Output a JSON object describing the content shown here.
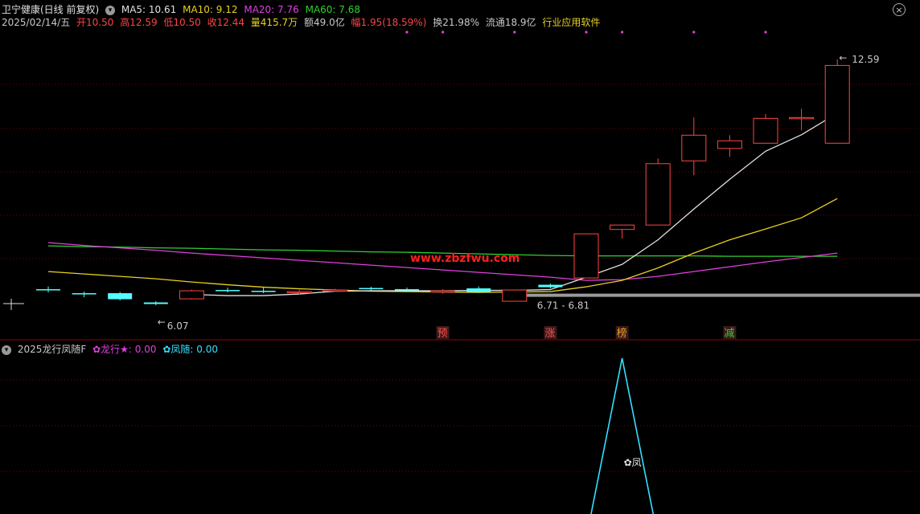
{
  "header": {
    "stock_name": "卫宁健康(日线 前复权)",
    "ma5": "MA5: 10.61",
    "ma10": "MA10: 9.12",
    "ma20": "MA20: 7.76",
    "ma60": "MA60: 7.68",
    "date": "2025/02/14/五",
    "open": "开10.50",
    "high": "高12.59",
    "low": "低10.50",
    "close": "收12.44",
    "volume": "量415.7万",
    "amount": "额49.0亿",
    "change": "幅1.95(18.59%)",
    "turnover": "换21.98%",
    "float": "流通18.9亿",
    "industry": "行业应用软件"
  },
  "indicator": {
    "name": "2025龙行凤随F",
    "long_label": "✿龙行★: 0.00",
    "feng_label": "✿凤随: 0.00",
    "feng_mark": "✿凤"
  },
  "colors": {
    "up": "#ff4444",
    "down": "#54ffff",
    "ma5": "#e0e0e0",
    "ma10": "#e8d020",
    "ma20": "#e040e0",
    "ma60": "#30d030",
    "grid": "#7a0000",
    "indicator": "#33e0ff"
  },
  "watermark": "www.zbzfwu.com",
  "chart_data": {
    "type": "candlestick",
    "price_range": [
      5.7,
      13.35
    ],
    "candles": [
      {
        "o": 6.86,
        "h": 6.93,
        "l": 6.78,
        "c": 6.84
      },
      {
        "o": 6.76,
        "h": 6.8,
        "l": 6.66,
        "c": 6.75
      },
      {
        "o": 6.76,
        "h": 6.79,
        "l": 6.58,
        "c": 6.61
      },
      {
        "o": 6.53,
        "h": 6.56,
        "l": 6.46,
        "c": 6.49
      },
      {
        "o": 6.62,
        "h": 6.85,
        "l": 6.6,
        "c": 6.82
      },
      {
        "o": 6.84,
        "h": 6.9,
        "l": 6.78,
        "c": 6.81
      },
      {
        "o": 6.82,
        "h": 6.9,
        "l": 6.76,
        "c": 6.79
      },
      {
        "o": 6.77,
        "h": 6.84,
        "l": 6.73,
        "c": 6.8
      },
      {
        "o": 6.82,
        "h": 6.87,
        "l": 6.8,
        "c": 6.84
      },
      {
        "o": 6.89,
        "h": 6.92,
        "l": 6.82,
        "c": 6.86
      },
      {
        "o": 6.86,
        "h": 6.9,
        "l": 6.84,
        "c": 6.85
      },
      {
        "o": 6.79,
        "h": 6.86,
        "l": 6.75,
        "c": 6.82
      },
      {
        "o": 6.88,
        "h": 6.93,
        "l": 6.77,
        "c": 6.79
      },
      {
        "o": 6.56,
        "h": 6.84,
        "l": 6.56,
        "c": 6.84
      },
      {
        "o": 6.97,
        "h": 7.0,
        "l": 6.88,
        "c": 6.91
      },
      {
        "o": 7.14,
        "h": 8.24,
        "l": 7.14,
        "c": 8.24
      },
      {
        "o": 8.35,
        "h": 8.46,
        "l": 8.12,
        "c": 8.46
      },
      {
        "o": 8.46,
        "h": 10.12,
        "l": 8.46,
        "c": 9.99
      },
      {
        "o": 10.06,
        "h": 11.14,
        "l": 9.7,
        "c": 10.7
      },
      {
        "o": 10.37,
        "h": 10.7,
        "l": 10.16,
        "c": 10.56
      },
      {
        "o": 10.5,
        "h": 11.23,
        "l": 10.5,
        "c": 11.12
      },
      {
        "o": 11.12,
        "h": 11.36,
        "l": 10.82,
        "c": 11.14
      },
      {
        "o": 10.5,
        "h": 12.59,
        "l": 10.5,
        "c": 12.44
      }
    ],
    "ma5": [
      null,
      null,
      null,
      null,
      6.73,
      6.7,
      6.7,
      6.74,
      6.81,
      6.82,
      6.82,
      6.82,
      6.83,
      6.83,
      6.85,
      7.16,
      7.48,
      8.09,
      8.86,
      9.6,
      10.3,
      10.71,
      11.25
    ],
    "ma10": [
      7.3,
      7.24,
      7.18,
      7.12,
      7.04,
      6.97,
      6.91,
      6.87,
      6.84,
      6.81,
      6.8,
      6.79,
      6.78,
      6.79,
      6.8,
      6.92,
      7.08,
      7.39,
      7.76,
      8.09,
      8.36,
      8.64,
      9.12
    ],
    "ma20": [
      8.02,
      7.95,
      7.89,
      7.83,
      7.76,
      7.7,
      7.64,
      7.58,
      7.52,
      7.46,
      7.4,
      7.34,
      7.28,
      7.22,
      7.16,
      7.08,
      7.1,
      7.18,
      7.3,
      7.42,
      7.54,
      7.65,
      7.76
    ],
    "ma60": [
      7.94,
      7.92,
      7.91,
      7.89,
      7.88,
      7.86,
      7.84,
      7.83,
      7.81,
      7.79,
      7.78,
      7.76,
      7.74,
      7.72,
      7.7,
      7.69,
      7.69,
      7.69,
      7.69,
      7.68,
      7.68,
      7.68,
      7.68
    ],
    "annotations": {
      "low_label": "6.07",
      "high_label": "12.59",
      "level_label": "6.71 - 6.81",
      "level_value": 6.71
    },
    "signals": [
      {
        "index": 11,
        "label": "预",
        "color": "#ff5050"
      },
      {
        "index": 14,
        "label": "涨",
        "color": "#ff5050"
      },
      {
        "index": 16,
        "label": "榜",
        "color": "#e8a020"
      },
      {
        "index": 19,
        "label": "减",
        "color": "#30d030"
      }
    ],
    "top_dots": [
      10,
      11,
      13,
      15,
      16,
      18,
      20
    ],
    "indicator_series": [
      0,
      0,
      0,
      0,
      0,
      0,
      0,
      0,
      0,
      0,
      0,
      0,
      0,
      0,
      0,
      0,
      1,
      0,
      0,
      0,
      0,
      0,
      0
    ]
  }
}
